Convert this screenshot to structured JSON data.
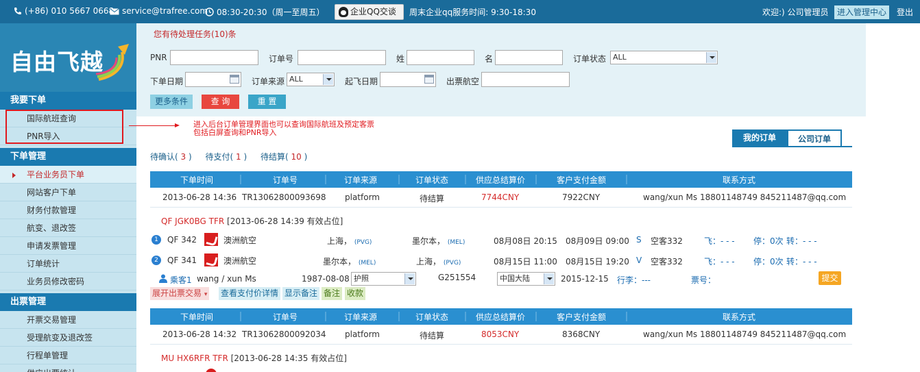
{
  "topbar": {
    "phone": "(+86) 010 5667 0668",
    "email": "service@trafree.com",
    "hours": "08:30-20:30（周一至周五）",
    "qq_button": "企业QQ交谈",
    "weekend": "周末企业qq服务时间: 9:30-18:30",
    "welcome": "欢迎:) 公司管理员",
    "admin_center": "进入管理中心",
    "logout": "登出",
    "colors": {
      "bar": "#1a6b9a",
      "admin_btn": "#bfe4ef"
    }
  },
  "sidebar": {
    "logo_text": "自由飞越",
    "sections": [
      {
        "title": "我要下单",
        "items": [
          "国际航班查询",
          "PNR导入"
        ]
      },
      {
        "title": "下单管理",
        "items": [
          "平台业务员下单",
          "网站客户下单",
          "财务付款管理",
          "航变、退改签",
          "申请发票管理",
          "订单统计",
          "业务员修改密码"
        ]
      },
      {
        "title": "出票管理",
        "items": [
          "开票交易管理",
          "受理航变及退改签",
          "行程单管理",
          "供应出票统计"
        ]
      }
    ]
  },
  "annotation": {
    "line1": "进入后台订单管理界面也可以查询国际航班及预定客票",
    "line2": "包括白屏查询和PNR导入"
  },
  "search": {
    "pending_tasks": "您有待处理任务(10)条",
    "pnr_label": "PNR",
    "order_no_label": "订单号",
    "surname_label": "姓",
    "given_name_label": "名",
    "order_status_label": "订单状态",
    "order_status_value": "ALL",
    "order_date_label": "下单日期",
    "order_source_label": "订单来源",
    "order_source_value": "ALL",
    "depart_date_label": "起飞日期",
    "airline_label": "出票航空",
    "more_btn": "更多条件",
    "query_btn": "查 询",
    "reset_btn": "重 置"
  },
  "status_tabs": {
    "pending_confirm": "待确认",
    "pending_confirm_count": "3",
    "pending_pay": "待支付",
    "pending_pay_count": "1",
    "pending_settle": "待结算",
    "pending_settle_count": "10"
  },
  "order_tabs": {
    "mine": "我的订单",
    "company": "公司订单"
  },
  "table_headers": [
    "下单时间",
    "订单号",
    "订单来源",
    "订单状态",
    "供应总结算价",
    "客户支付金额",
    "联系方式"
  ],
  "orders": [
    {
      "time": "2013-06-28 14:36",
      "order_no": "TR13062800093698",
      "source": "platform",
      "status": "待结算",
      "supply_price": "7744CNY",
      "customer_pay": "7922CNY",
      "contact": "wang/xun Ms  18801148749  845211487@qq.com",
      "pnr_line_code": "QF JGK0BG TFR",
      "pnr_line_rest": " [2013-06-28 14:39 有效占位]",
      "segments": [
        {
          "num": "1",
          "flight": "QF 342",
          "airline": "澳洲航空",
          "from": "上海，",
          "from_code": "(PVG)",
          "to": "墨尔本，",
          "to_code": "(MEL)",
          "dep": "08月08日 20:15",
          "arr": "08月09日 09:00",
          "cabin": "S",
          "aircraft": "空客332",
          "fly": "飞：- - -",
          "stop": "停：0次",
          "transfer": "转：- - -"
        },
        {
          "num": "2",
          "flight": "QF 341",
          "airline": "澳洲航空",
          "from": "墨尔本，",
          "from_code": "(MEL)",
          "to": "上海，",
          "to_code": "(PVG)",
          "dep": "08月15日 11:00",
          "arr": "08月15日 19:20",
          "cabin": "V",
          "aircraft": "空客332",
          "fly": "飞：- - -",
          "stop": "停：0次",
          "transfer": "转：- - -"
        }
      ],
      "passenger": {
        "label": "乘客1",
        "name": "wang / xun Ms",
        "birth": "1987-08-08",
        "doc_type": "护照",
        "doc_no": "G251554",
        "nationality": "中国大陆",
        "expiry": "2015-12-15",
        "baggage": "行李：---",
        "ticket_no": "票号：",
        "submit": "提交"
      },
      "actions": [
        "展开出票交易",
        "查看支付价详情",
        "显示备注",
        "备注",
        "收款"
      ]
    },
    {
      "time": "2013-06-28 14:32",
      "order_no": "TR13062800092034",
      "source": "platform",
      "status": "待结算",
      "supply_price": "8053CNY",
      "customer_pay": "8368CNY",
      "contact": "wang/xun Ms  18801148749  845211487@qq.com",
      "pnr_line_code": "MU HX6RFR TFR",
      "pnr_line_rest": " [2013-06-28 14:35 有效占位]"
    }
  ]
}
